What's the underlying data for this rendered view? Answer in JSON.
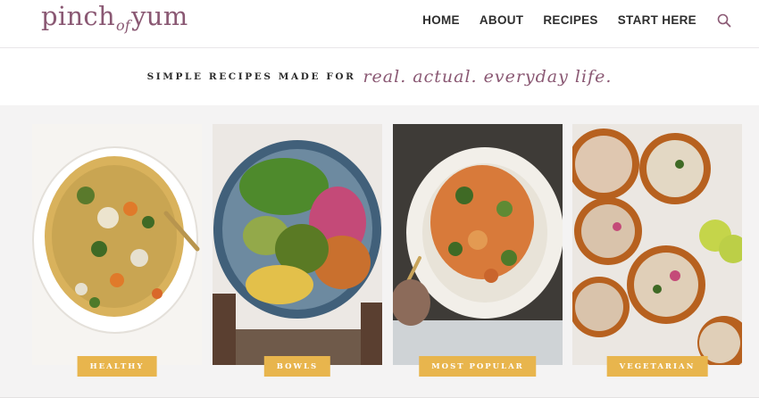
{
  "logo": {
    "part1": "pinch",
    "part2": "of",
    "part3": "yum"
  },
  "nav": {
    "items": [
      "HOME",
      "ABOUT",
      "RECIPES",
      "START HERE"
    ],
    "search_icon": "search-icon"
  },
  "tagline": {
    "lead": "SIMPLE RECIPES MADE FOR",
    "script": "real. actual. everyday life."
  },
  "categories": [
    {
      "label": "HEALTHY"
    },
    {
      "label": "BOWLS"
    },
    {
      "label": "MOST POPULAR"
    },
    {
      "label": "VEGETARIAN"
    }
  ],
  "colors": {
    "brand": "#8a5873",
    "accent": "#e8b54d",
    "text": "#2e2e2e",
    "band": "#f4f3f3"
  }
}
